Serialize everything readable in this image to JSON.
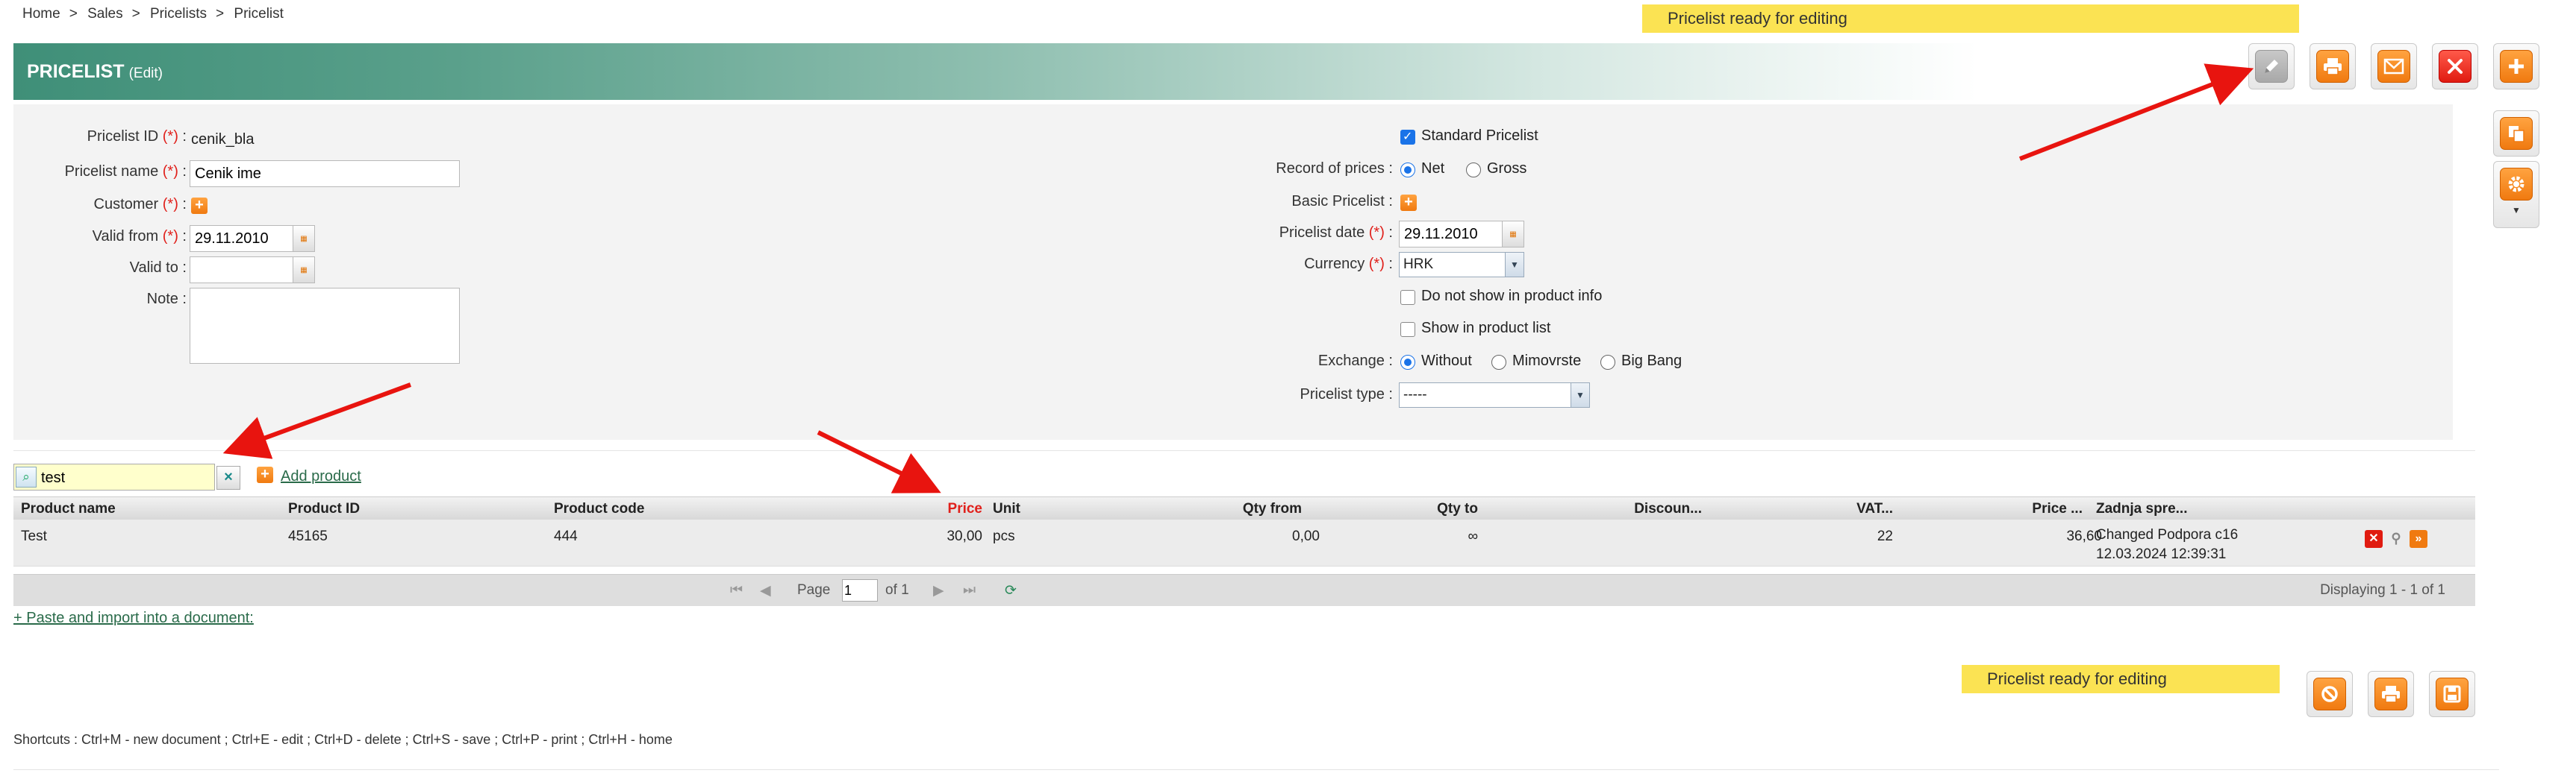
{
  "breadcrumb": [
    "Home",
    "Sales",
    "Pricelists",
    "Pricelist"
  ],
  "breadcrumb_sep": ">",
  "status_message": "Pricelist ready for editing",
  "header": {
    "title": "PRICELIST",
    "mode": "(Edit)"
  },
  "toolbar_icons": [
    "pencil-icon",
    "printer-icon",
    "envelope-icon",
    "close-icon",
    "plus-icon",
    "copy-icon",
    "gear-icon",
    "chevron-down-icon"
  ],
  "form": {
    "req": "(*)",
    "pricelist_id": {
      "label": "Pricelist ID",
      "value": "cenik_bla"
    },
    "pricelist_name": {
      "label": "Pricelist name",
      "value": "Cenik ime"
    },
    "customer": {
      "label": "Customer"
    },
    "valid_from": {
      "label": "Valid from",
      "value": "29.11.2010"
    },
    "valid_to": {
      "label": "Valid to",
      "value": ""
    },
    "note": {
      "label": "Note",
      "value": ""
    },
    "standard_pricelist": {
      "label": "Standard Pricelist",
      "checked": true
    },
    "record_of_prices": {
      "label": "Record of prices",
      "options": [
        "Net",
        "Gross"
      ],
      "selected": "Net"
    },
    "basic_pricelist": {
      "label": "Basic Pricelist"
    },
    "pricelist_date": {
      "label": "Pricelist date",
      "value": "29.11.2010"
    },
    "currency": {
      "label": "Currency",
      "value": "HRK"
    },
    "do_not_show": {
      "label": "Do not show in product info",
      "checked": false
    },
    "show_in_list": {
      "label": "Show in product list",
      "checked": false
    },
    "exchange": {
      "label": "Exchange",
      "options": [
        "Without",
        "Mimovrste",
        "Big Bang"
      ],
      "selected": "Without"
    },
    "pricelist_type": {
      "label": "Pricelist type",
      "value": "-----"
    }
  },
  "search": {
    "value": "test",
    "clear": "×",
    "add_label": "Add product"
  },
  "grid": {
    "columns": [
      "Product name",
      "Product ID",
      "Product code",
      "Price",
      "Unit",
      "Qty from",
      "Qty to",
      "Discoun...",
      "VAT...",
      "Price ...",
      "Zadnja spre..."
    ],
    "rows": [
      {
        "name": "Test",
        "id": "45165",
        "code": "444",
        "price": "30,00",
        "unit": "pcs",
        "qty_from": "0,00",
        "qty_to": "∞",
        "discount": "",
        "vat": "22",
        "price2": "36,60",
        "change_line1": "Changed Podpora c16",
        "change_line2": "12.03.2024 12:39:31"
      }
    ]
  },
  "pager": {
    "page_label": "Page",
    "page": "1",
    "of_label": "of 1",
    "display": "Displaying 1 - 1 of 1"
  },
  "paste_link": "+ Paste and import into a document:",
  "shortcuts": "Shortcuts : Ctrl+M - new document ;   Ctrl+E - edit ;   Ctrl+D - delete ;   Ctrl+S - save ;   Ctrl+P - print ;   Ctrl+H - home",
  "colors": {
    "accent": "#3f8f78",
    "banner": "#fbe353",
    "orange": "#f07a10",
    "red": "#e01b10",
    "arrow": "#e8140f"
  }
}
